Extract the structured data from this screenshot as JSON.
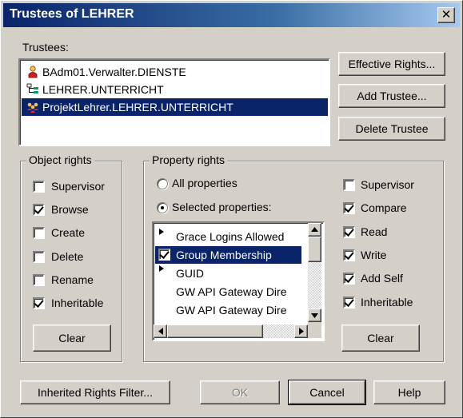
{
  "window": {
    "title": "Trustees of LEHRER",
    "close_glyph": "✕"
  },
  "trustees": {
    "label": "Trustees:",
    "items": [
      {
        "name": "BAdm01.Verwalter.DIENSTE",
        "icon": "user-icon",
        "selected": false
      },
      {
        "name": "LEHRER.UNTERRICHT",
        "icon": "organizational-unit-icon",
        "selected": false
      },
      {
        "name": "ProjektLehrer.LEHRER.UNTERRICHT",
        "icon": "group-icon",
        "selected": true
      }
    ]
  },
  "buttons": {
    "effective_rights": "Effective Rights...",
    "add_trustee": "Add Trustee...",
    "delete_trustee": "Delete Trustee",
    "clear_object": "Clear",
    "clear_property": "Clear",
    "inherited_filter": "Inherited Rights Filter...",
    "ok": "OK",
    "cancel": "Cancel",
    "help": "Help"
  },
  "object_rights": {
    "label": "Object rights",
    "items": [
      {
        "label": "Supervisor",
        "checked": false
      },
      {
        "label": "Browse",
        "checked": true
      },
      {
        "label": "Create",
        "checked": false
      },
      {
        "label": "Delete",
        "checked": false
      },
      {
        "label": "Rename",
        "checked": false
      },
      {
        "label": "Inheritable",
        "checked": true
      }
    ]
  },
  "property_rights": {
    "label": "Property rights",
    "all_properties": "All properties",
    "selected_properties": "Selected properties:",
    "selected_mode": "selected",
    "properties": [
      {
        "name": "Grace Logins Allowed",
        "has_rights": false
      },
      {
        "name": "Group Membership",
        "has_rights": true,
        "selected": true
      },
      {
        "name": "GUID",
        "has_rights": false
      },
      {
        "name": "GW API Gateway Dire",
        "has_rights": false
      },
      {
        "name": "GW API Gateway Dire",
        "has_rights": false
      }
    ],
    "rights": [
      {
        "label": "Supervisor",
        "checked": false
      },
      {
        "label": "Compare",
        "checked": true
      },
      {
        "label": "Read",
        "checked": true
      },
      {
        "label": "Write",
        "checked": true
      },
      {
        "label": "Add Self",
        "checked": true
      },
      {
        "label": "Inheritable",
        "checked": true
      }
    ]
  },
  "colors": {
    "selection": "#0a246a",
    "face": "#d4d0c8"
  }
}
